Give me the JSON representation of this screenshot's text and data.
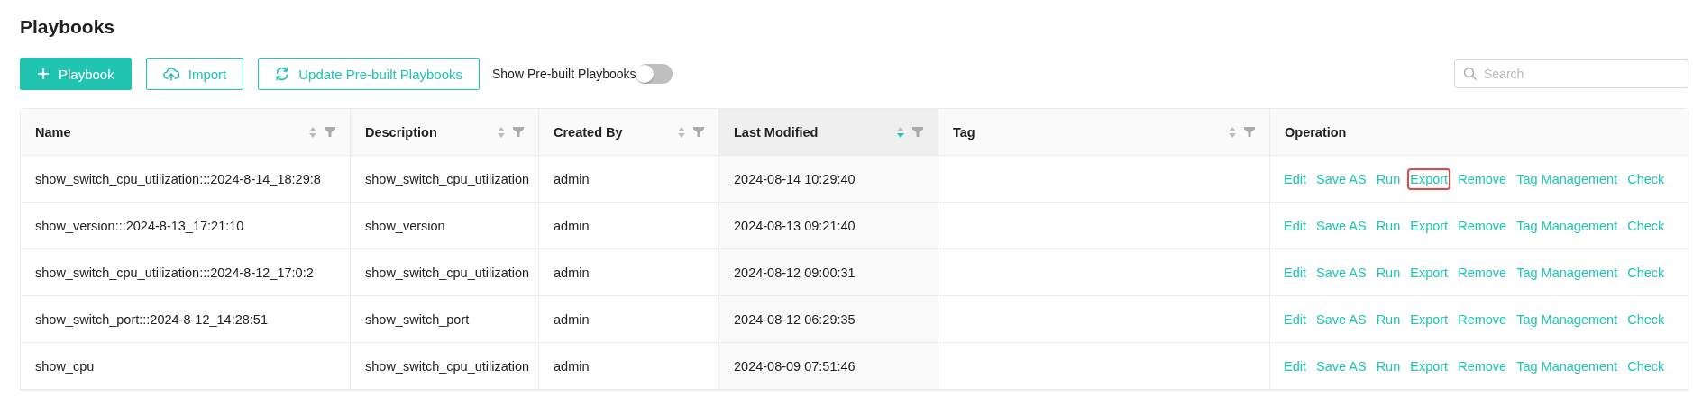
{
  "page": {
    "title": "Playbooks"
  },
  "toolbar": {
    "buttons": [
      {
        "label": "Playbook",
        "kind": "primary"
      },
      {
        "label": "Import",
        "kind": "outline"
      },
      {
        "label": "Update Pre-built Playbooks",
        "kind": "outline"
      }
    ],
    "toggle": {
      "label": "Show Pre-built Playbooks",
      "on": false
    },
    "search": {
      "placeholder": "Search"
    }
  },
  "table": {
    "columns": [
      {
        "label": "Name",
        "sorted": false,
        "filter": true
      },
      {
        "label": "Description",
        "sorted": false,
        "filter": true
      },
      {
        "label": "Created By",
        "sorted": false,
        "filter": true
      },
      {
        "label": "Last Modified",
        "sorted": true,
        "filter": true
      },
      {
        "label": "Tag",
        "sorted": false,
        "filter": true
      },
      {
        "label": "Operation"
      }
    ],
    "rows": [
      {
        "cells": [
          "show_switch_cpu_utilization:::2024-8-14_18:29:8",
          "show_switch_cpu_utilization",
          "admin",
          "2024-08-14 10:29:40",
          ""
        ],
        "actions": [
          {
            "label": "Edit",
            "highlighted": false
          },
          {
            "label": "Save AS",
            "highlighted": false
          },
          {
            "label": "Run",
            "highlighted": false
          },
          {
            "label": "Export",
            "highlighted": true
          },
          {
            "label": "Remove",
            "highlighted": false
          },
          {
            "label": "Tag Management",
            "highlighted": false
          },
          {
            "label": "Check",
            "highlighted": false
          }
        ]
      },
      {
        "cells": [
          "show_version:::2024-8-13_17:21:10",
          "show_version",
          "admin",
          "2024-08-13 09:21:40",
          ""
        ],
        "actions": [
          {
            "label": "Edit",
            "highlighted": false
          },
          {
            "label": "Save AS",
            "highlighted": false
          },
          {
            "label": "Run",
            "highlighted": false
          },
          {
            "label": "Export",
            "highlighted": false
          },
          {
            "label": "Remove",
            "highlighted": false
          },
          {
            "label": "Tag Management",
            "highlighted": false
          },
          {
            "label": "Check",
            "highlighted": false
          }
        ]
      },
      {
        "cells": [
          "show_switch_cpu_utilization:::2024-8-12_17:0:2",
          "show_switch_cpu_utilization",
          "admin",
          "2024-08-12 09:00:31",
          ""
        ],
        "actions": [
          {
            "label": "Edit",
            "highlighted": false
          },
          {
            "label": "Save AS",
            "highlighted": false
          },
          {
            "label": "Run",
            "highlighted": false
          },
          {
            "label": "Export",
            "highlighted": false
          },
          {
            "label": "Remove",
            "highlighted": false
          },
          {
            "label": "Tag Management",
            "highlighted": false
          },
          {
            "label": "Check",
            "highlighted": false
          }
        ]
      },
      {
        "cells": [
          "show_switch_port:::2024-8-12_14:28:51",
          "show_switch_port",
          "admin",
          "2024-08-12 06:29:35",
          ""
        ],
        "actions": [
          {
            "label": "Edit",
            "highlighted": false
          },
          {
            "label": "Save AS",
            "highlighted": false
          },
          {
            "label": "Run",
            "highlighted": false
          },
          {
            "label": "Export",
            "highlighted": false
          },
          {
            "label": "Remove",
            "highlighted": false
          },
          {
            "label": "Tag Management",
            "highlighted": false
          },
          {
            "label": "Check",
            "highlighted": false
          }
        ]
      },
      {
        "cells": [
          "show_cpu",
          "show_switch_cpu_utilization",
          "admin",
          "2024-08-09 07:51:46",
          ""
        ],
        "actions": [
          {
            "label": "Edit",
            "highlighted": false
          },
          {
            "label": "Save AS",
            "highlighted": false
          },
          {
            "label": "Run",
            "highlighted": false
          },
          {
            "label": "Export",
            "highlighted": false
          },
          {
            "label": "Remove",
            "highlighted": false
          },
          {
            "label": "Tag Management",
            "highlighted": false
          },
          {
            "label": "Check",
            "highlighted": false
          }
        ]
      }
    ]
  }
}
